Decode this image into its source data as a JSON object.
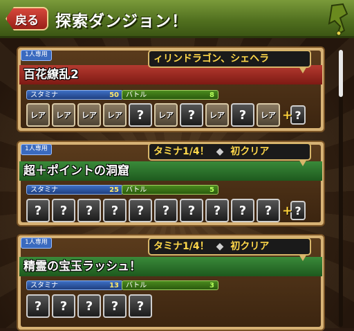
{
  "header": {
    "back_label": "戻る",
    "title": "探索ダンジョン！"
  },
  "dungeons": [
    {
      "solo_tag": "1人専用",
      "name": "百花繚乱2",
      "callout": "ィリンドラゴン、シェヘラ",
      "stamina_label": "スタミナ",
      "stamina": "50",
      "battle_label": "バトル",
      "battle": "8",
      "rare_label": "レア",
      "unknown_label": "?",
      "plus_label": "+"
    },
    {
      "solo_tag": "1人専用",
      "name": "超＋ポイントの洞窟",
      "callout_left": "タミナ1/4！",
      "callout_sep": "◆",
      "callout_right": "初クリア",
      "stamina_label": "スタミナ",
      "stamina": "25",
      "battle_label": "バトル",
      "battle": "5",
      "unknown_label": "?",
      "plus_label": "+"
    },
    {
      "solo_tag": "1人専用",
      "name": "精霊の宝玉ラッシュ！",
      "callout_left": "タミナ1/4！",
      "callout_sep": "◆",
      "callout_right": "初クリア",
      "stamina_label": "スタミナ",
      "stamina": "13",
      "battle_label": "バトル",
      "battle": "3",
      "unknown_label": "?"
    }
  ],
  "icons": {
    "header_decoration": "dragon-icon"
  },
  "colors": {
    "header_green": "#4f6e1e",
    "back_red": "#c0392b",
    "banner_red": "#9a2a22",
    "banner_green": "#2a7a2a",
    "callout_text": "#ffd84a"
  }
}
